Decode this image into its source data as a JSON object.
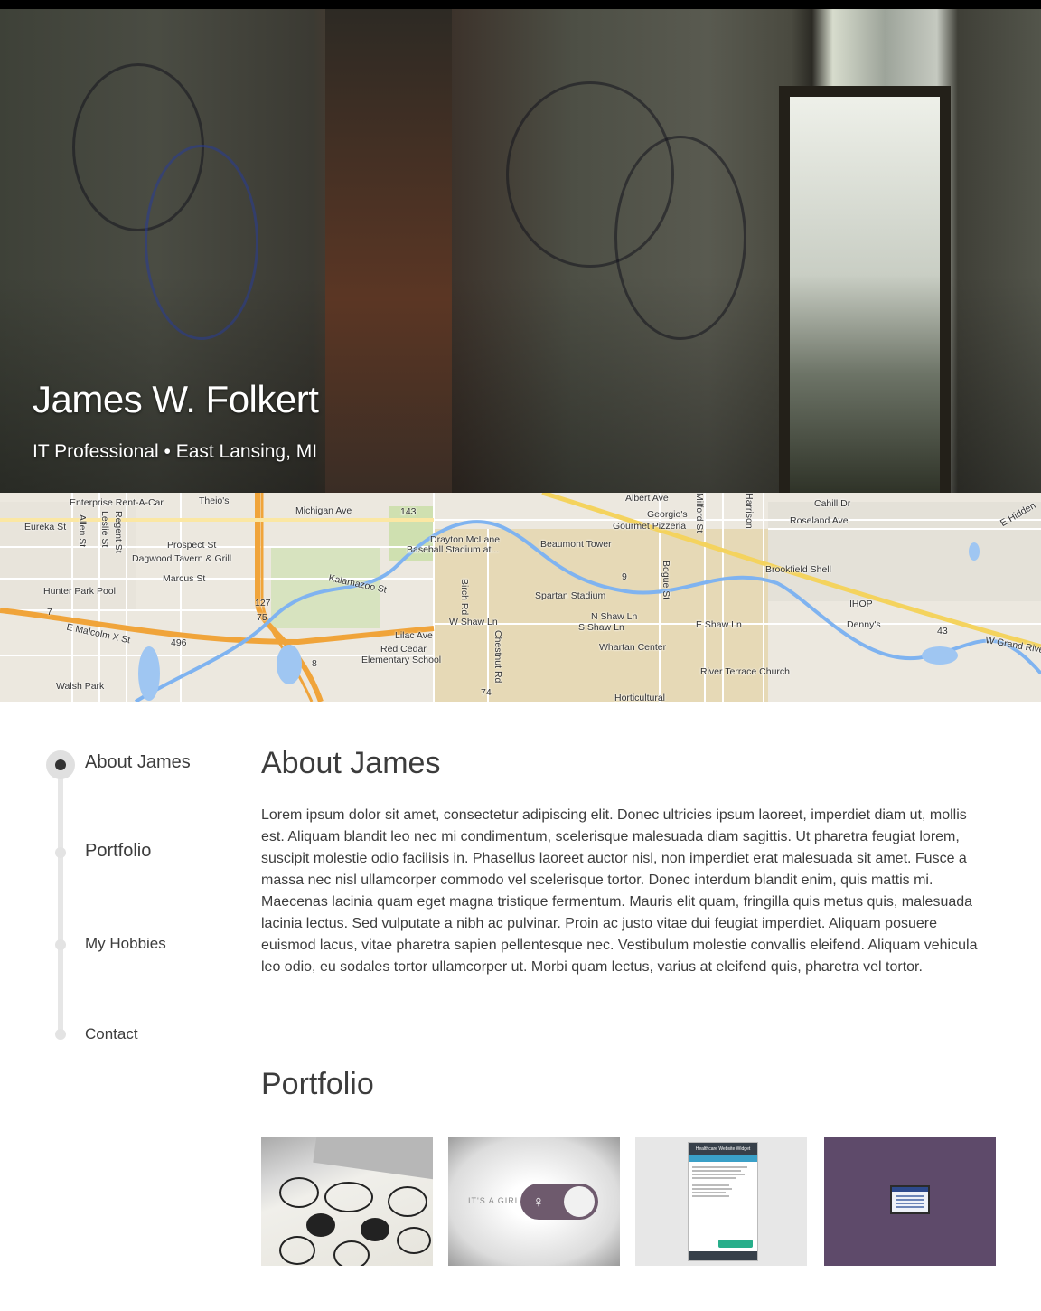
{
  "hero": {
    "name": "James W. Folkert",
    "subtitle": "IT Professional • East Lansing, MI"
  },
  "map": {
    "labels": [
      "Enterprise Rent-A-Car",
      "Theio's",
      "Michigan Ave",
      "143",
      "Albert Ave",
      "Georgio's",
      "Gourmet Pizzeria",
      "Cahill Dr",
      "Roseland Ave",
      "Eureka St",
      "Allen St",
      "Regent St",
      "Leslie St",
      "Prospect St",
      "Dagwood Tavern & Grill",
      "Marcus St",
      "Drayton McLane",
      "Baseball Stadium at...",
      "Beaumont Tower",
      "Hunter Park Pool",
      "Kalamazoo St",
      "127",
      "75",
      "Birch Rd",
      "Spartan Stadium",
      "Bogue St",
      "Brookfield Shell",
      "IHOP",
      "Denny's",
      "E Malcolm X St",
      "496",
      "Lilac Ave",
      "Red Cedar",
      "Elementary School",
      "W Shaw Ln",
      "N Shaw Ln",
      "S Shaw Ln",
      "E Shaw Ln",
      "Whartan Center",
      "43",
      "W Grand River",
      "Chestnut Rd",
      "8",
      "Walsh Park",
      "74",
      "River Terrace Church",
      "Horticultural",
      "Milford St",
      "9",
      "7",
      "E Hidden",
      "Harrison"
    ]
  },
  "nav": {
    "items": [
      {
        "label": "About James"
      },
      {
        "label": "Portfolio"
      },
      {
        "label": "My Hobbies"
      },
      {
        "label": "Contact"
      }
    ]
  },
  "about": {
    "title": "About James",
    "body": "Lorem ipsum dolor sit amet, consectetur adipiscing elit. Donec ultricies ipsum laoreet, imperdiet diam ut, mollis est. Aliquam blandit leo nec mi condimentum, scelerisque malesuada diam sagittis. Ut pharetra feugiat lorem, suscipit molestie odio facilisis in. Phasellus laoreet auctor nisl, non imperdiet erat malesuada sit amet. Fusce a massa nec nisl ullamcorper commodo vel scelerisque tortor. Donec interdum blandit enim, quis mattis mi. Maecenas lacinia quam eget magna tristique fermentum. Mauris elit quam, fringilla quis metus quis, malesuada lacinia lectus. Sed vulputate a nibh ac pulvinar. Proin ac justo vitae dui feugiat imperdiet. Aliquam posuere euismod lacus, vitae pharetra sapien pellentesque nec. Vestibulum molestie convallis eleifend. Aliquam vehicula leo odio, eu sodales tortor ullamcorper ut. Morbi quam lectus, varius at eleifend quis, pharetra vel tortor."
  },
  "portfolio": {
    "title": "Portfolio",
    "thumb2_label": "IT'S A GIRL",
    "thumb3_header": "Healthcare Website Widget"
  }
}
